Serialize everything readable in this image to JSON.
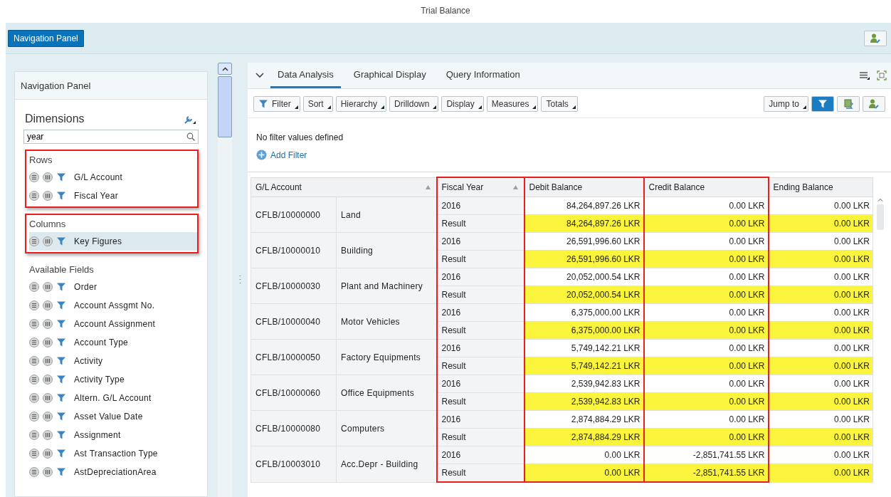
{
  "window": {
    "title": "Trial Balance"
  },
  "top_bar": {
    "button": "Navigation Panel"
  },
  "navigation_panel": {
    "title": "Navigation Panel",
    "heading": "Dimensions",
    "search": {
      "value": "year"
    },
    "sections": [
      {
        "label": "Rows",
        "highlighted": true,
        "items": [
          {
            "label": "G/L Account",
            "selected": false
          },
          {
            "label": "Fiscal Year",
            "selected": false
          }
        ]
      },
      {
        "label": "Columns",
        "highlighted": true,
        "items": [
          {
            "label": "Key Figures",
            "selected": true
          }
        ]
      },
      {
        "label": "Available Fields",
        "highlighted": false,
        "items": [
          {
            "label": "Order",
            "selected": false
          },
          {
            "label": "Account Assgmt No.",
            "selected": false
          },
          {
            "label": "Account Assignment",
            "selected": false
          },
          {
            "label": "Account Type",
            "selected": false
          },
          {
            "label": "Activity",
            "selected": false
          },
          {
            "label": "Activity Type",
            "selected": false
          },
          {
            "label": "Altern. G/L Account",
            "selected": false
          },
          {
            "label": "Asset Value Date",
            "selected": false
          },
          {
            "label": "Assignment",
            "selected": false
          },
          {
            "label": "Ast Transaction Type",
            "selected": false
          },
          {
            "label": "AstDepreciationArea",
            "selected": false
          }
        ]
      }
    ]
  },
  "tabs": [
    {
      "label": "Data Analysis",
      "selected": true
    },
    {
      "label": "Graphical Display",
      "selected": false
    },
    {
      "label": "Query Information",
      "selected": false
    }
  ],
  "toolbar": {
    "buttons": [
      {
        "label": "Filter",
        "kind": "filter"
      },
      {
        "label": "Sort",
        "kind": "text"
      },
      {
        "label": "Hierarchy",
        "kind": "text"
      },
      {
        "label": "Drilldown",
        "kind": "text"
      },
      {
        "label": "Display",
        "kind": "text"
      },
      {
        "label": "Measures",
        "kind": "text"
      },
      {
        "label": "Totals",
        "kind": "text"
      }
    ],
    "right_buttons": [
      {
        "kind": "text",
        "label": "Jump to",
        "selected": false
      },
      {
        "kind": "filter",
        "selected": true
      },
      {
        "kind": "swap",
        "selected": false
      },
      {
        "kind": "person",
        "selected": false
      }
    ]
  },
  "filter_bar": {
    "message": "No filter values defined",
    "add_filter": "Add Filter"
  },
  "table": {
    "columns": [
      {
        "label": "G/L Account",
        "sortable": true,
        "highlighted": false
      },
      {
        "label": "Fiscal Year",
        "sortable": true,
        "highlighted": true
      },
      {
        "label": "Debit Balance",
        "sortable": false,
        "highlighted": true
      },
      {
        "label": "Credit Balance",
        "sortable": false,
        "highlighted": true
      },
      {
        "label": "Ending Balance",
        "sortable": false,
        "highlighted": false
      }
    ],
    "accounts": [
      {
        "code": "CFLB/10000000",
        "name": "Land",
        "lines": [
          {
            "kind": "value",
            "year": "2016",
            "debit": "84,264,897.26 LKR",
            "credit": "0.00 LKR",
            "ending": "0.00 LKR"
          },
          {
            "kind": "result",
            "year": "Result",
            "debit": "84,264,897.26 LKR",
            "credit": "0.00 LKR",
            "ending": "0.00 LKR"
          }
        ]
      },
      {
        "code": "CFLB/10000010",
        "name": "Building",
        "lines": [
          {
            "kind": "value",
            "year": "2016",
            "debit": "26,591,996.60 LKR",
            "credit": "0.00 LKR",
            "ending": "0.00 LKR"
          },
          {
            "kind": "result",
            "year": "Result",
            "debit": "26,591,996.60 LKR",
            "credit": "0.00 LKR",
            "ending": "0.00 LKR"
          }
        ]
      },
      {
        "code": "CFLB/10000030",
        "name": "Plant and Machinery",
        "lines": [
          {
            "kind": "value",
            "year": "2016",
            "debit": "20,052,000.54 LKR",
            "credit": "0.00 LKR",
            "ending": "0.00 LKR"
          },
          {
            "kind": "result",
            "year": "Result",
            "debit": "20,052,000.54 LKR",
            "credit": "0.00 LKR",
            "ending": "0.00 LKR"
          }
        ]
      },
      {
        "code": "CFLB/10000040",
        "name": "Motor Vehicles",
        "lines": [
          {
            "kind": "value",
            "year": "2016",
            "debit": "6,375,000.00 LKR",
            "credit": "0.00 LKR",
            "ending": "0.00 LKR"
          },
          {
            "kind": "result",
            "year": "Result",
            "debit": "6,375,000.00 LKR",
            "credit": "0.00 LKR",
            "ending": "0.00 LKR"
          }
        ]
      },
      {
        "code": "CFLB/10000050",
        "name": "Factory Equipments",
        "lines": [
          {
            "kind": "value",
            "year": "2016",
            "debit": "5,749,142.21 LKR",
            "credit": "0.00 LKR",
            "ending": "0.00 LKR"
          },
          {
            "kind": "result",
            "year": "Result",
            "debit": "5,749,142.21 LKR",
            "credit": "0.00 LKR",
            "ending": "0.00 LKR"
          }
        ]
      },
      {
        "code": "CFLB/10000060",
        "name": "Office Equipments",
        "lines": [
          {
            "kind": "value",
            "year": "2016",
            "debit": "2,539,942.83 LKR",
            "credit": "0.00 LKR",
            "ending": "0.00 LKR"
          },
          {
            "kind": "result",
            "year": "Result",
            "debit": "2,539,942.83 LKR",
            "credit": "0.00 LKR",
            "ending": "0.00 LKR"
          }
        ]
      },
      {
        "code": "CFLB/10000080",
        "name": "Computers",
        "lines": [
          {
            "kind": "value",
            "year": "2016",
            "debit": "2,874,884.29 LKR",
            "credit": "0.00 LKR",
            "ending": "0.00 LKR"
          },
          {
            "kind": "result",
            "year": "Result",
            "debit": "2,874,884.29 LKR",
            "credit": "0.00 LKR",
            "ending": "0.00 LKR"
          }
        ]
      },
      {
        "code": "CFLB/10003010",
        "name": "Acc.Depr - Building",
        "lines": [
          {
            "kind": "value",
            "year": "2016",
            "debit": "0.00 LKR",
            "credit": "-2,851,741.55 LKR",
            "ending": "0.00 LKR"
          },
          {
            "kind": "result",
            "year": "Result",
            "debit": "0.00 LKR",
            "credit": "-2,851,741.55 LKR",
            "ending": "0.00 LKR"
          }
        ]
      }
    ]
  }
}
